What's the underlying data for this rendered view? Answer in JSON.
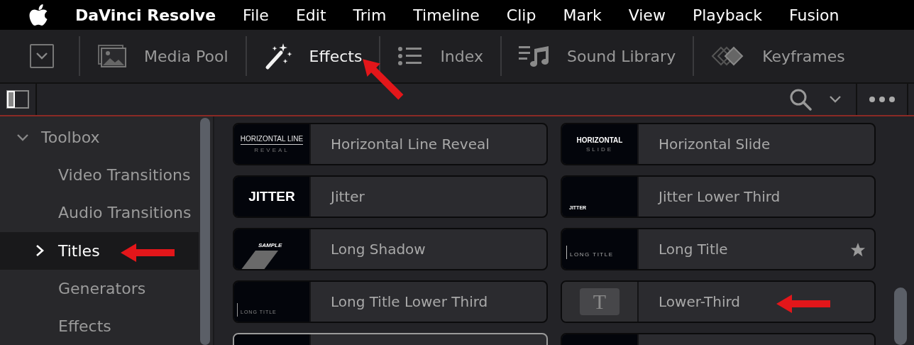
{
  "menu_bar": {
    "app_name": "DaVinci Resolve",
    "items": [
      "File",
      "Edit",
      "Trim",
      "Timeline",
      "Clip",
      "Mark",
      "View",
      "Playback",
      "Fusion"
    ]
  },
  "toolbar": {
    "tabs": [
      {
        "label": "Media Pool",
        "kind": "media",
        "selected": false
      },
      {
        "label": "Effects",
        "kind": "effects",
        "selected": true,
        "annotation_arrow": true
      },
      {
        "label": "Index",
        "kind": "index",
        "selected": false
      },
      {
        "label": "Sound Library",
        "kind": "sound",
        "selected": false
      },
      {
        "label": "Keyframes",
        "kind": "keyframes",
        "selected": false
      }
    ]
  },
  "sidebar": {
    "items": [
      {
        "label": "Toolbox",
        "expanded": true,
        "selected": false,
        "children": [
          {
            "label": "Video Transitions",
            "selected": false
          },
          {
            "label": "Audio Transitions",
            "selected": false
          },
          {
            "label": "Titles",
            "expanded": false,
            "selected": true,
            "annotation_arrow": true
          },
          {
            "label": "Generators",
            "selected": false
          },
          {
            "label": "Effects",
            "selected": false
          }
        ]
      }
    ]
  },
  "tiles": [
    {
      "name": "Horizontal Line Reveal",
      "thumbnail": {
        "kind": "underlined",
        "lines": [
          "HORIZONTAL LINE",
          "REVEAL"
        ]
      },
      "selected": false
    },
    {
      "name": "Horizontal Slide",
      "thumbnail": {
        "kind": "stacked",
        "lines": [
          "HORIZONTAL",
          "SLIDE"
        ]
      },
      "selected": false
    },
    {
      "name": "Jitter",
      "thumbnail": {
        "kind": "big",
        "lines": [
          "JITTER"
        ]
      },
      "selected": false
    },
    {
      "name": "Jitter Lower Third",
      "thumbnail": {
        "kind": "lower",
        "lines": [
          "JITTER"
        ]
      },
      "selected": false
    },
    {
      "name": "Long Shadow",
      "thumbnail": {
        "kind": "shadow",
        "lines": [
          "SAMPLE"
        ]
      },
      "selected": false
    },
    {
      "name": "Long Title",
      "thumbnail": {
        "kind": "bar",
        "lines": [
          "LONG TITLE"
        ]
      },
      "favorite": true,
      "selected": false
    },
    {
      "name": "Long Title Lower Third",
      "thumbnail": {
        "kind": "bar_lower",
        "lines": [
          "LONG TITLE"
        ]
      },
      "selected": false
    },
    {
      "name": "Lower-Third",
      "thumbnail": {
        "kind": "letter",
        "lines": [
          "T"
        ]
      },
      "selected": false,
      "annotation_arrow": true
    },
    {
      "thumbnail": {
        "kind": "blank"
      },
      "selected": true
    },
    {
      "thumbnail": {
        "kind": "blank"
      },
      "selected": false
    }
  ]
}
